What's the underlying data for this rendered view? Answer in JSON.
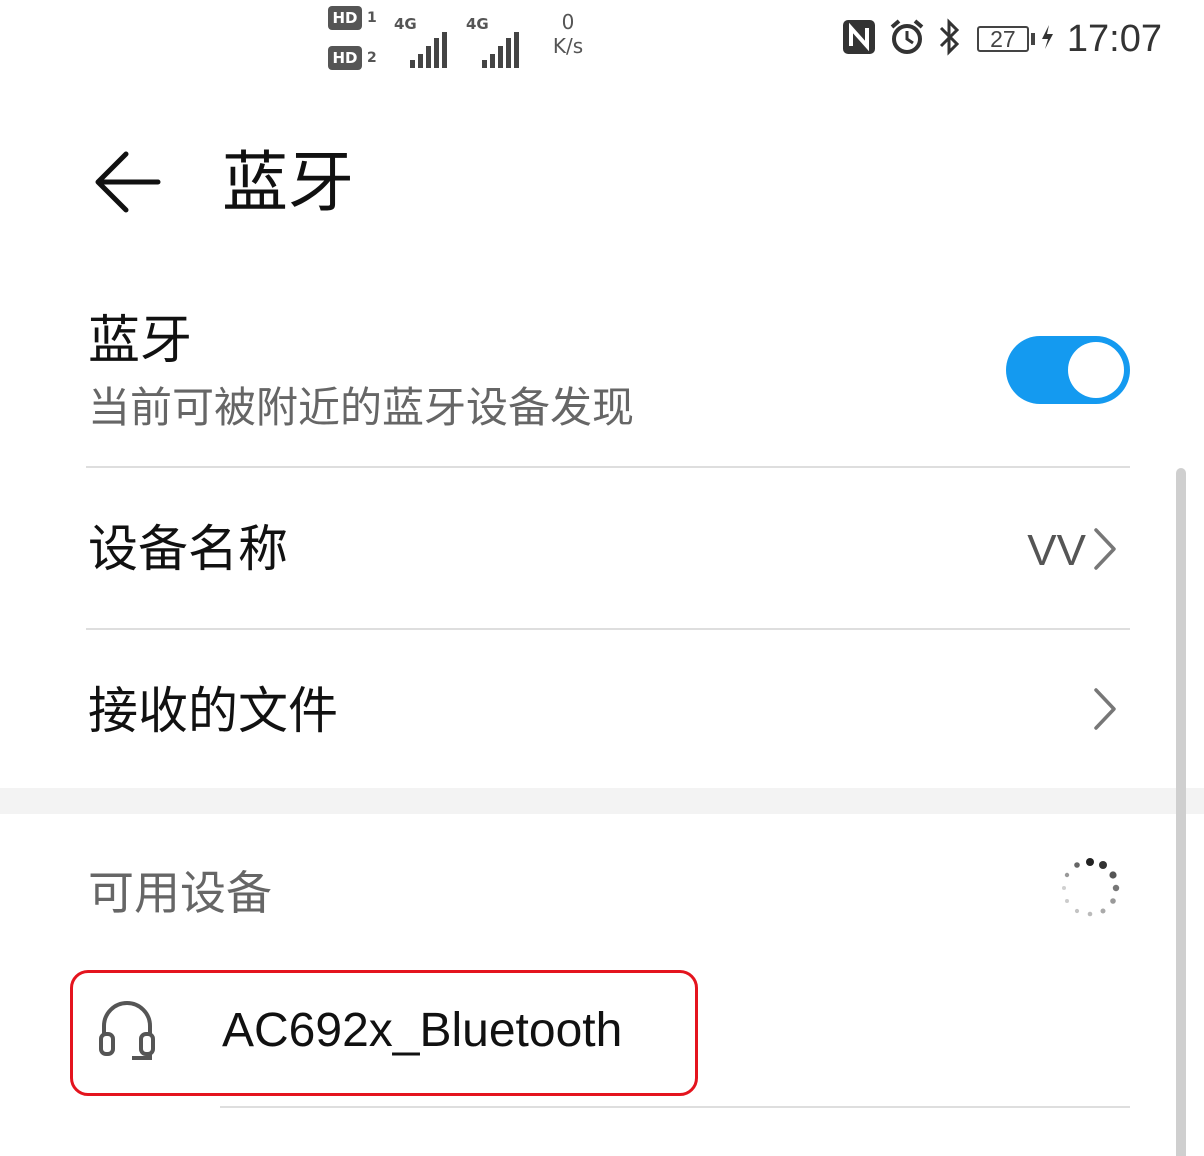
{
  "status_bar": {
    "hd_badge_1": "HD",
    "hd_sim_1": "1",
    "hd_badge_2": "HD",
    "hd_sim_2": "2",
    "network_1": "4G",
    "network_2": "4G",
    "speed_value": "0",
    "speed_unit": "K/s",
    "battery": "27",
    "time": "17:07",
    "icons": [
      "nfc-icon",
      "alarm-icon",
      "bluetooth-icon",
      "battery-icon",
      "charging-icon"
    ]
  },
  "header": {
    "title": "蓝牙",
    "back_icon": "arrow-left-icon"
  },
  "bluetooth": {
    "label": "蓝牙",
    "subtitle": "当前可被附近的蓝牙设备发现",
    "enabled": true,
    "toggle_color": "#149af0"
  },
  "settings": {
    "device_name_label": "设备名称",
    "device_name_value": "VV",
    "received_files_label": "接收的文件"
  },
  "available": {
    "title": "可用设备",
    "scanning": true,
    "devices": [
      {
        "name": "AC692x_Bluetooth",
        "icon": "headset-icon",
        "highlighted": true
      }
    ]
  },
  "colors": {
    "accent": "#149af0",
    "highlight": "#e4141e"
  }
}
